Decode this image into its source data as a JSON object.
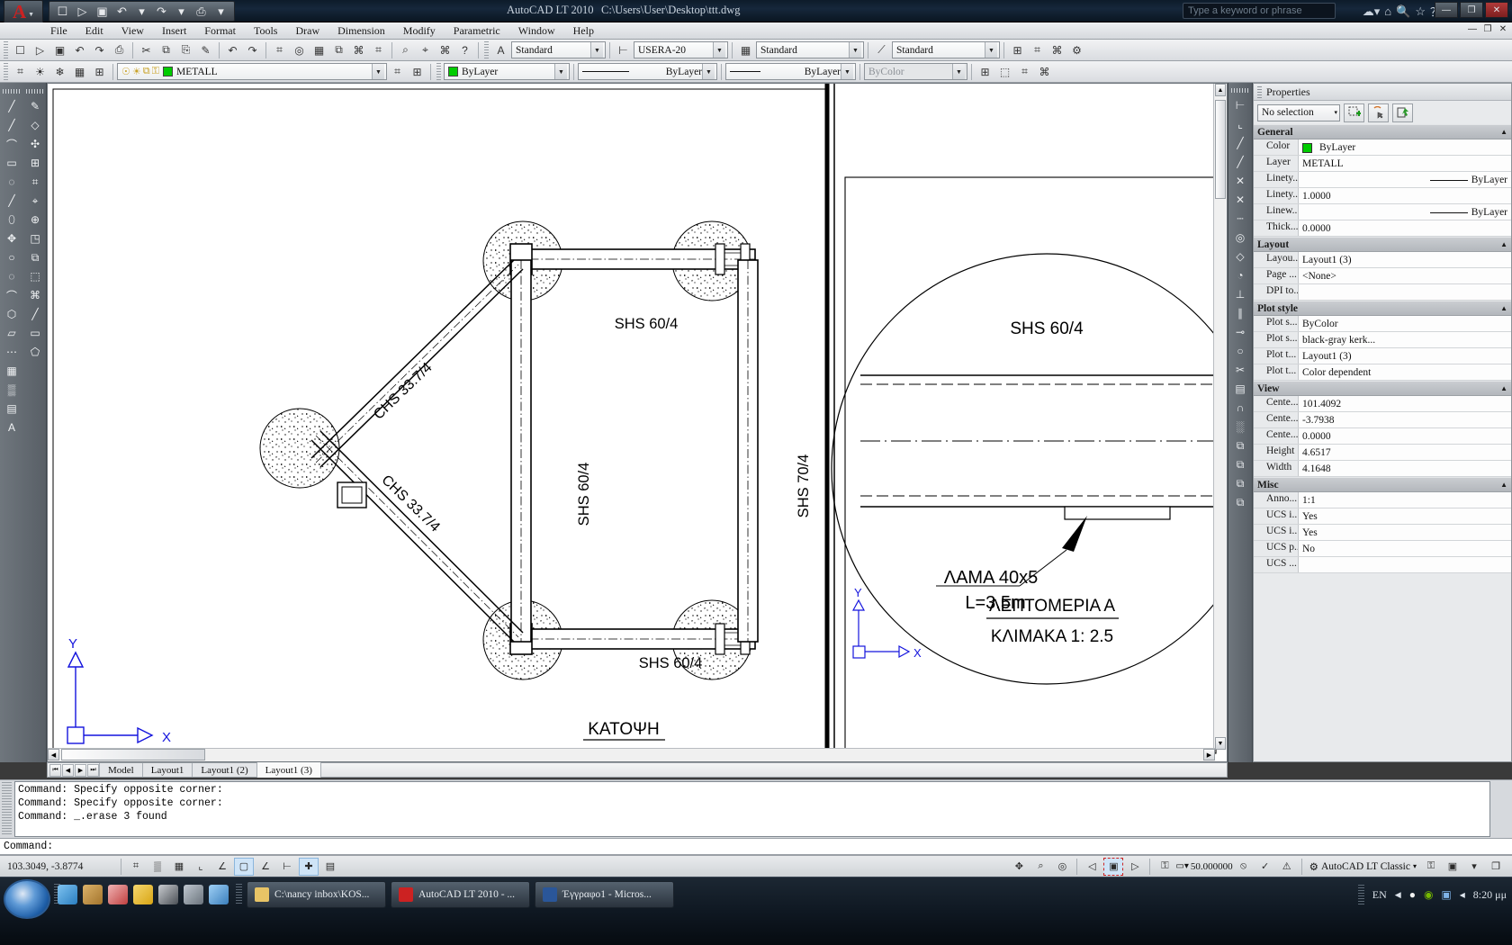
{
  "titlebar": {
    "app_title": "AutoCAD LT 2010",
    "file_path": "C:\\Users\\User\\Desktop\\ttt.dwg",
    "search_placeholder": "Type a keyword or phrase",
    "quick_access": [
      {
        "name": "new-file",
        "glyph": "☐"
      },
      {
        "name": "open-file",
        "glyph": "▷"
      },
      {
        "name": "save-file",
        "glyph": "▣"
      },
      {
        "name": "undo",
        "glyph": "↶"
      },
      {
        "name": "undo-dropdown",
        "glyph": "▾"
      },
      {
        "name": "redo",
        "glyph": "↷"
      },
      {
        "name": "redo-dropdown",
        "glyph": "▾"
      },
      {
        "name": "plot",
        "glyph": "⎙"
      },
      {
        "name": "qat-dropdown",
        "glyph": "▾"
      }
    ],
    "window_buttons": [
      "—",
      "❐",
      "✕"
    ]
  },
  "menubar": {
    "items": [
      "File",
      "Edit",
      "View",
      "Insert",
      "Format",
      "Tools",
      "Draw",
      "Dimension",
      "Modify",
      "Parametric",
      "Window",
      "Help"
    ],
    "doc_buttons": [
      "—",
      "❐",
      "✕"
    ]
  },
  "toolbar_row1": {
    "groups": [
      [
        "☐",
        "▷",
        "▣",
        "↶",
        "↷",
        "⎙"
      ],
      [
        "✂",
        "⧉",
        "⎘",
        "✎"
      ],
      [
        "↶",
        "↷"
      ],
      [
        "⌗",
        "◎",
        "▦",
        "⧉",
        "⌘",
        "⌗"
      ],
      [
        "⌕",
        "⌖",
        "⌘",
        "?"
      ]
    ],
    "text_style": {
      "label": "Standard",
      "icon": "A"
    },
    "dim_style": {
      "label": "USERA-20",
      "icon": "dimension-icon"
    },
    "table_style": {
      "label": "Standard",
      "icon": "table-icon"
    },
    "mleader_style": {
      "label": "Standard",
      "icon": "mleader-icon"
    },
    "right_buttons": [
      "⊞",
      "⌗",
      "⌘",
      "⚙"
    ]
  },
  "toolbar_row2": {
    "layer_tools": [
      "⌗",
      "☀",
      "❄",
      "▦",
      "⊞"
    ],
    "layer_state_icons": [
      "☉",
      "☀",
      "⧉",
      "⚿"
    ],
    "layer": {
      "name": "METALL",
      "color": "#00cc00"
    },
    "after_layer_buttons": [
      "⌗",
      "⊞"
    ],
    "color": {
      "label": "ByLayer",
      "swatch": "#00cc00"
    },
    "linetype": {
      "label": "ByLayer"
    },
    "lineweight": {
      "label": "ByLayer"
    },
    "plotstyle": {
      "label": "ByColor",
      "disabled": true
    },
    "right_buttons": [
      "⊞",
      "⬚",
      "⌗",
      "⌘"
    ]
  },
  "left_toolbar_a": [
    "╱",
    "╱",
    "⌒",
    "▭",
    "◌",
    "╱",
    "⬯",
    "✥",
    "○",
    "◌",
    "⌒",
    "⬡",
    "▱",
    "⋯",
    "▦",
    "▒",
    "▤",
    "A"
  ],
  "left_toolbar_b": [
    "✎",
    "◇",
    "✣",
    "⊞",
    "⌗",
    "⌖",
    "⊕",
    "◳",
    "⧉",
    "⬚",
    "⌘",
    "╱",
    "▭",
    "⬠"
  ],
  "left_toolbar_c": [
    "⊢",
    "⌀",
    "⌐",
    "↺",
    "↗",
    "⌒",
    "∥",
    "⌐",
    "⌖",
    "◱",
    "▧",
    "⚓",
    "⟲"
  ],
  "right_toolbar": [
    "⊢",
    "⌞",
    "╱",
    "╱",
    "✕",
    "✕",
    "┄",
    "◎",
    "◇",
    "◔",
    "⊥",
    "∥",
    "⊸",
    "○",
    "✂",
    "▤",
    "∩",
    "░",
    "⧉",
    "⧉",
    "⧉",
    "⧉"
  ],
  "drawing": {
    "plan": {
      "labels": [
        {
          "text": "SHS 60/4",
          "name": "label-shs-60-4-top"
        },
        {
          "text": "SHS 60/4",
          "name": "label-shs-60-4-mid"
        },
        {
          "text": "SHS 70/4",
          "name": "label-shs-70-4-right"
        },
        {
          "text": "SHS 60/4",
          "name": "label-shs-60-4-bottom"
        },
        {
          "text": "CHS 33.7/4",
          "name": "label-chs-upper-brace"
        },
        {
          "text": "CHS 33.7/4",
          "name": "label-chs-lower-brace"
        }
      ],
      "title": "ΚΑΤΟΨΗ",
      "ucs": {
        "x": "X",
        "y": "Y"
      }
    },
    "detail": {
      "member_label": "SHS 60/4",
      "plate_label": "ΛΑΜΑ 40x5",
      "plate_length": "L=3.5m",
      "title": "ΛΕΠΤΟΜΕΡΙΑ Α",
      "scale": "ΚΛΙΜΑΚΑ 1: 2.5",
      "ucs": {
        "x": "X",
        "y": "Y"
      }
    }
  },
  "layout_tabs": {
    "nav": [
      "⏮",
      "◀",
      "▶",
      "⏭"
    ],
    "tabs": [
      {
        "label": "Model",
        "active": false
      },
      {
        "label": "Layout1",
        "active": false
      },
      {
        "label": "Layout1 (2)",
        "active": false
      },
      {
        "label": "Layout1 (3)",
        "active": true
      }
    ]
  },
  "command_line": {
    "history": [
      "Command: Specify opposite corner:",
      "Command: Specify opposite corner:",
      "Command: _.erase 3 found"
    ],
    "prompt": "Command:"
  },
  "status_bar": {
    "coordinates": "103.3049, -3.8774",
    "toggles": [
      {
        "name": "infer-constraints",
        "glyph": "⌗",
        "on": false
      },
      {
        "name": "snap-mode",
        "glyph": "▒",
        "on": false
      },
      {
        "name": "grid-display",
        "glyph": "▦",
        "on": false
      },
      {
        "name": "ortho-mode",
        "glyph": "⌞",
        "on": false
      },
      {
        "name": "polar-tracking",
        "glyph": "∠",
        "on": false
      },
      {
        "name": "object-snap",
        "glyph": "▢",
        "on": true
      },
      {
        "name": "object-snap-tracking",
        "glyph": "∠",
        "on": false
      },
      {
        "name": "dynamic-ucs",
        "glyph": "⊢",
        "on": false
      },
      {
        "name": "dynamic-input",
        "glyph": "✚",
        "on": true
      },
      {
        "name": "show-lineweight",
        "glyph": "▤",
        "on": false
      }
    ],
    "right_tools": [
      {
        "name": "pan",
        "glyph": "✥"
      },
      {
        "name": "zoom",
        "glyph": "⌕"
      },
      {
        "name": "steering-wheel",
        "glyph": "◎"
      }
    ],
    "layout_tools": [
      {
        "name": "model-space",
        "glyph": "◁"
      },
      {
        "name": "paper-space",
        "glyph": "▣"
      },
      {
        "name": "next-viewport",
        "glyph": "▷"
      }
    ],
    "annotation_lock": "⚿",
    "annotation_scale": "50.000000",
    "annotation_vis": [
      {
        "name": "annotation-visibility",
        "glyph": "⦸"
      },
      {
        "name": "auto-scale",
        "glyph": "✓"
      },
      {
        "name": "annotation-monitor",
        "glyph": "⚠"
      }
    ],
    "workspace": {
      "label": "AutoCAD LT Classic",
      "icon": "gear-icon",
      "arrow": "▾"
    },
    "trailing": [
      {
        "name": "toolbar-lock",
        "glyph": "⚿"
      },
      {
        "name": "tray-settings",
        "glyph": "▣"
      },
      {
        "name": "tray-dropdown",
        "glyph": "▾"
      },
      {
        "name": "clean-screen",
        "glyph": "❐"
      }
    ]
  },
  "taskbar": {
    "items": [
      {
        "label": "C:\\nancy inbox\\KOS...",
        "icon_color": "#e8c466",
        "name": "taskbar-item-explorer"
      },
      {
        "label": "AutoCAD LT 2010 - ...",
        "icon_color": "#cc2222",
        "name": "taskbar-item-autocad"
      },
      {
        "label": "Έγγραφο1 - Micros...",
        "icon_color": "#2a5699",
        "name": "taskbar-item-word"
      }
    ],
    "tray": {
      "language": "EN",
      "arrow": "◀",
      "icons": [
        {
          "name": "antivirus-icon",
          "glyph": "●",
          "color": "#f2f2f2"
        },
        {
          "name": "nvidia-icon",
          "glyph": "◉",
          "color": "#76b900"
        },
        {
          "name": "network-icon",
          "glyph": "▣",
          "color": "#7fb3e8"
        },
        {
          "name": "volume-icon",
          "glyph": "◂",
          "color": "#dfe6ee"
        }
      ],
      "clock": "8:20 μμ"
    }
  },
  "properties": {
    "title": "Properties",
    "selection": "No selection",
    "selection_arrow": "▾",
    "top_buttons": [
      {
        "name": "quick-select-button",
        "glyph": "⬚"
      },
      {
        "name": "select-objects-button",
        "glyph": "↖"
      },
      {
        "name": "pickadd-button",
        "glyph": "⊞"
      }
    ],
    "groups": [
      {
        "title": "General",
        "rows": [
          {
            "key": "Color",
            "value": "ByLayer",
            "swatch": "#00cc00"
          },
          {
            "key": "Layer",
            "value": "METALL"
          },
          {
            "key": "Linety...",
            "value": "ByLayer",
            "line": true
          },
          {
            "key": "Linety...",
            "value": "1.0000"
          },
          {
            "key": "Linew...",
            "value": "ByLayer",
            "line": true
          },
          {
            "key": "Thick...",
            "value": "0.0000"
          }
        ]
      },
      {
        "title": "Layout",
        "rows": [
          {
            "key": "Layou...",
            "value": "Layout1 (3)"
          },
          {
            "key": "Page ...",
            "value": "<None>"
          },
          {
            "key": "DPI to...",
            "value": ""
          }
        ]
      },
      {
        "title": "Plot style",
        "rows": [
          {
            "key": "Plot s...",
            "value": "ByColor"
          },
          {
            "key": "Plot s...",
            "value": "black-gray kerk..."
          },
          {
            "key": "Plot t...",
            "value": "Layout1 (3)"
          },
          {
            "key": "Plot t...",
            "value": "Color dependent"
          }
        ]
      },
      {
        "title": "View",
        "rows": [
          {
            "key": "Cente...",
            "value": "101.4092"
          },
          {
            "key": "Cente...",
            "value": "-3.7938"
          },
          {
            "key": "Cente...",
            "value": "0.0000"
          },
          {
            "key": "Height",
            "value": "4.6517"
          },
          {
            "key": "Width",
            "value": "4.1648"
          }
        ]
      },
      {
        "title": "Misc",
        "rows": [
          {
            "key": "Anno...",
            "value": "1:1"
          },
          {
            "key": "UCS i...",
            "value": "Yes"
          },
          {
            "key": "UCS i...",
            "value": "Yes"
          },
          {
            "key": "UCS p...",
            "value": "No"
          },
          {
            "key": "UCS ...",
            "value": ""
          }
        ]
      }
    ]
  }
}
